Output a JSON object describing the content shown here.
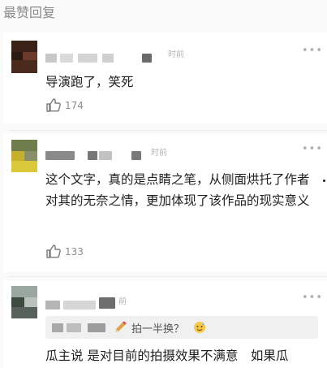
{
  "section": {
    "title": "最赞回复"
  },
  "comments": [
    {
      "time": "时前",
      "text": "导演跑了，笑死",
      "likes": "174"
    },
    {
      "time": "时前",
      "text": "这个文字，真的是点睛之笔，从侧面烘托了作者对其的无奈之情，更加体现了该作品的现实意义",
      "likes": "133"
    },
    {
      "time": "前",
      "quote": "拍一半换？",
      "text": "瓜主说 是对目前的拍摄效果不满意　如果瓜"
    }
  ],
  "icons": {
    "more": "more-dots-icon",
    "like": "thumbs-up-icon",
    "quote": "pencil-icon",
    "emoji": "sweat-smile-emoji-icon"
  }
}
